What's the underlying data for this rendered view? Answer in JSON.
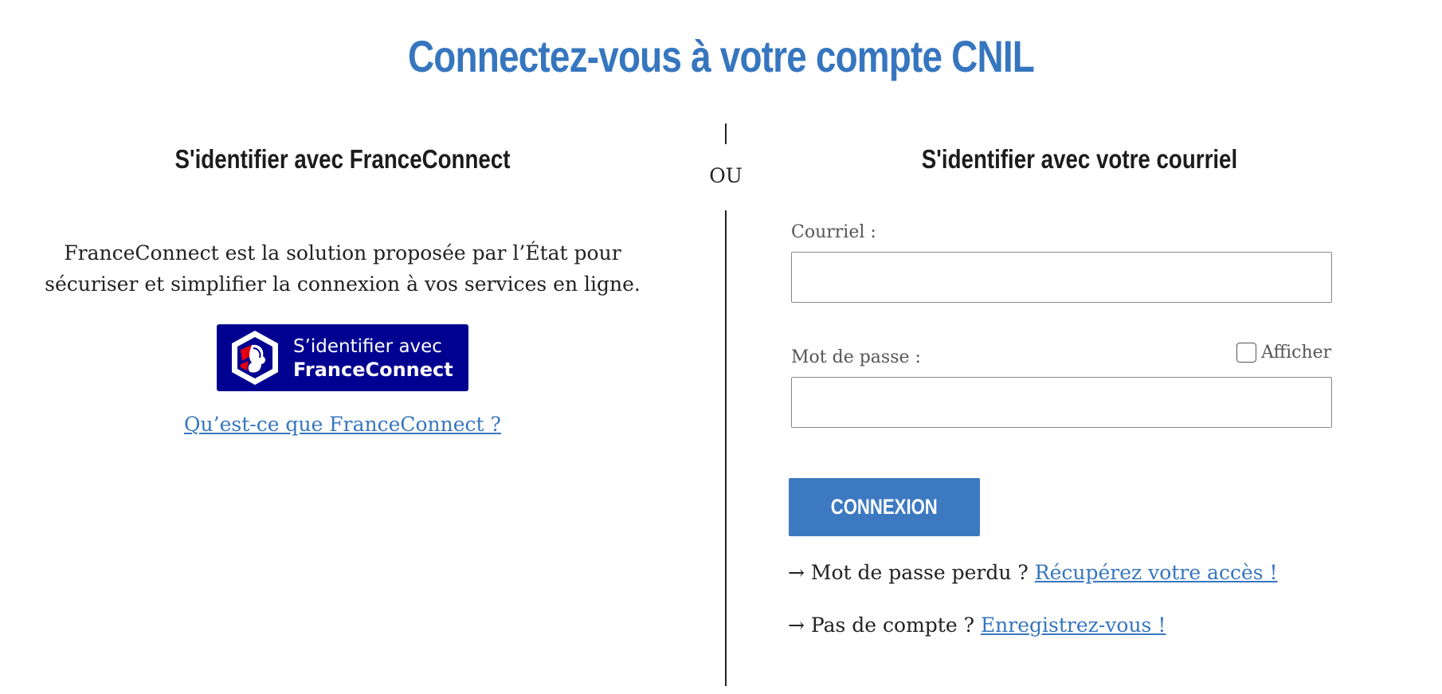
{
  "page": {
    "title": "Connectez-vous à votre compte CNIL"
  },
  "divider": {
    "text": "OU"
  },
  "franceconnect": {
    "heading": "S'identifier avec FranceConnect",
    "description": "FranceConnect est la solution proposée par l’État pour sécuriser et simplifier la connexion à vos services en ligne.",
    "button_line1": "S’identifier avec",
    "button_line2": "FranceConnect",
    "button_color": "#000091",
    "help_link": "Qu’est-ce que FranceConnect ?"
  },
  "email_login": {
    "heading": "S'identifier avec votre courriel",
    "email_label": "Courriel :",
    "email_value": "",
    "password_label": "Mot de passe :",
    "password_value": "",
    "show_password_label": "Afficher",
    "show_password_checked": false,
    "submit_label": "CONNEXION",
    "accent_color": "#3676bf"
  },
  "help": {
    "lost_password_arrow": "→",
    "lost_password_text": "Mot de passe perdu ?",
    "lost_password_link": "Récupérez votre accès !",
    "register_arrow": "→",
    "register_text": "Pas de compte ?",
    "register_link": "Enregistrez-vous !"
  }
}
